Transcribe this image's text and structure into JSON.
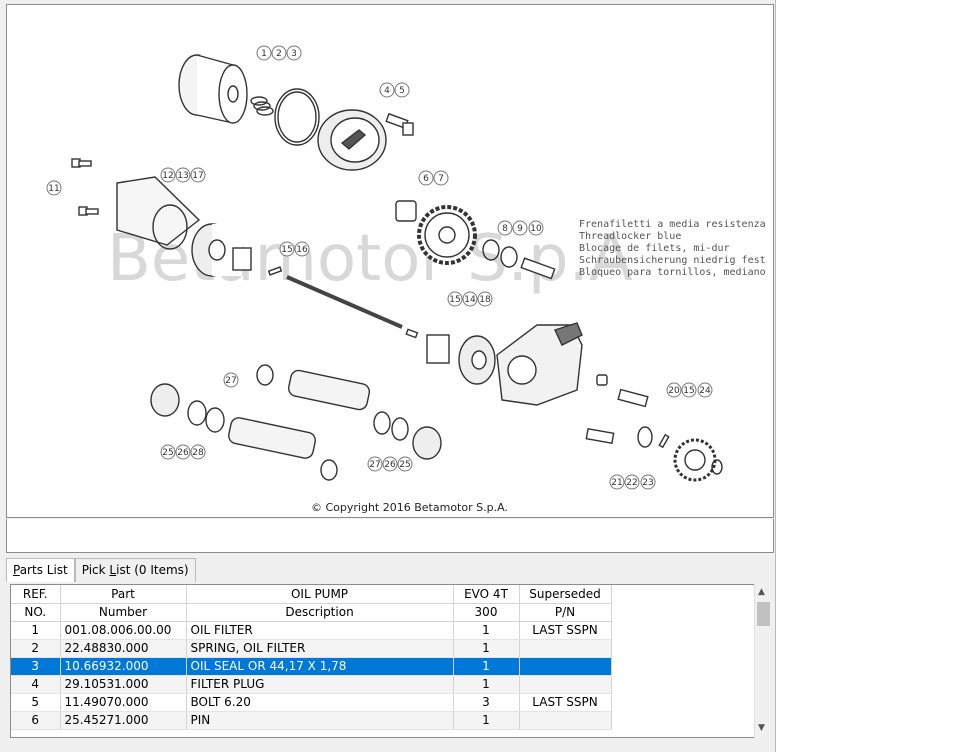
{
  "diagram": {
    "watermark": "Betamotor S.p.A",
    "copyright": "© Copyright 2016 Betamotor S.p.A.",
    "note_lines": [
      "Frenafiletti a media resistenza",
      "Threadlocker blue",
      "Blocage de filets, mi-dur",
      "Schraubensicherung niedrig fest",
      "Bloqueo para tornillos, mediano"
    ],
    "callouts": [
      "1",
      "2",
      "3",
      "4",
      "5",
      "6",
      "7",
      "8",
      "9",
      "10",
      "11",
      "12",
      "13",
      "17",
      "15",
      "16",
      "15",
      "14",
      "18",
      "27",
      "20",
      "15",
      "24",
      "25",
      "26",
      "28",
      "27",
      "26",
      "25",
      "21",
      "22",
      "23"
    ]
  },
  "tabs": [
    {
      "label": "Parts List",
      "active": true
    },
    {
      "label": "Pick List (0 Items)",
      "active": false
    }
  ],
  "table": {
    "header_row1": [
      "REF.",
      "Part",
      "OIL PUMP",
      "EVO 4T",
      "Superseded"
    ],
    "header_row2": [
      "NO.",
      "Number",
      "Description",
      "300",
      "P/N"
    ],
    "rows": [
      {
        "ref": "1",
        "part": "001.08.006.00.00",
        "desc": "OIL FILTER",
        "qty": "1",
        "superseded": "LAST SSPN"
      },
      {
        "ref": "2",
        "part": "22.48830.000",
        "desc": "SPRING, OIL FILTER",
        "qty": "1",
        "superseded": ""
      },
      {
        "ref": "3",
        "part": "10.66932.000",
        "desc": "OIL SEAL OR 44,17 X 1,78",
        "qty": "1",
        "superseded": ""
      },
      {
        "ref": "4",
        "part": "29.10531.000",
        "desc": "FILTER PLUG",
        "qty": "1",
        "superseded": ""
      },
      {
        "ref": "5",
        "part": "11.49070.000",
        "desc": "BOLT 6.20",
        "qty": "3",
        "superseded": "LAST SSPN"
      },
      {
        "ref": "6",
        "part": "25.45271.000",
        "desc": "PIN",
        "qty": "1",
        "superseded": ""
      }
    ],
    "selected_index": 2
  },
  "scrollbar": {
    "up": "▲",
    "down": "▼"
  }
}
